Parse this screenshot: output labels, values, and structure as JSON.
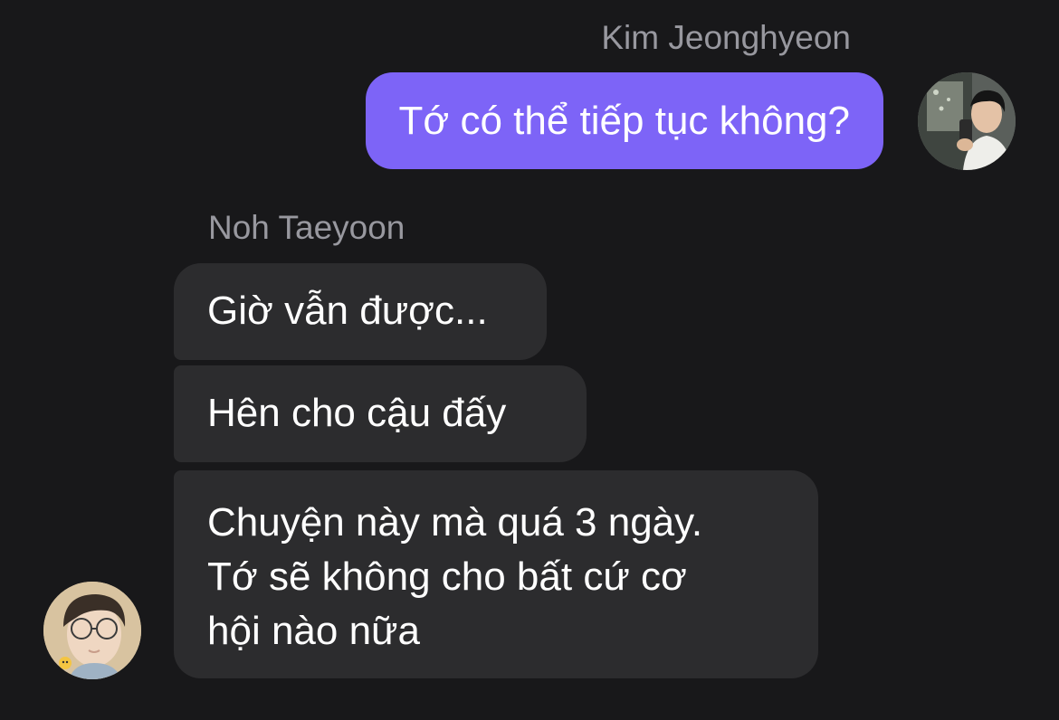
{
  "conversation": {
    "outgoing": {
      "sender": "Kim Jeonghyeon",
      "messages": [
        "Tớ có thể tiếp tục không?"
      ]
    },
    "incoming": {
      "sender": "Noh Taeyoon",
      "messages": [
        "Giờ vẫn được...",
        "Hên cho cậu đấy",
        {
          "lines": [
            "Chuyện này mà quá 3 ngày.",
            "Tớ sẽ không cho bất cứ cơ",
            "hội nào nữa"
          ]
        }
      ]
    }
  },
  "colors": {
    "background": "#18181a",
    "outgoing_bubble": "#7d64f7",
    "incoming_bubble": "#2c2c2e",
    "sender_name": "#98989f",
    "message_text": "#ffffff"
  },
  "icons": {
    "outgoing_avatar": "profile-photo",
    "incoming_avatar": "profile-photo"
  }
}
